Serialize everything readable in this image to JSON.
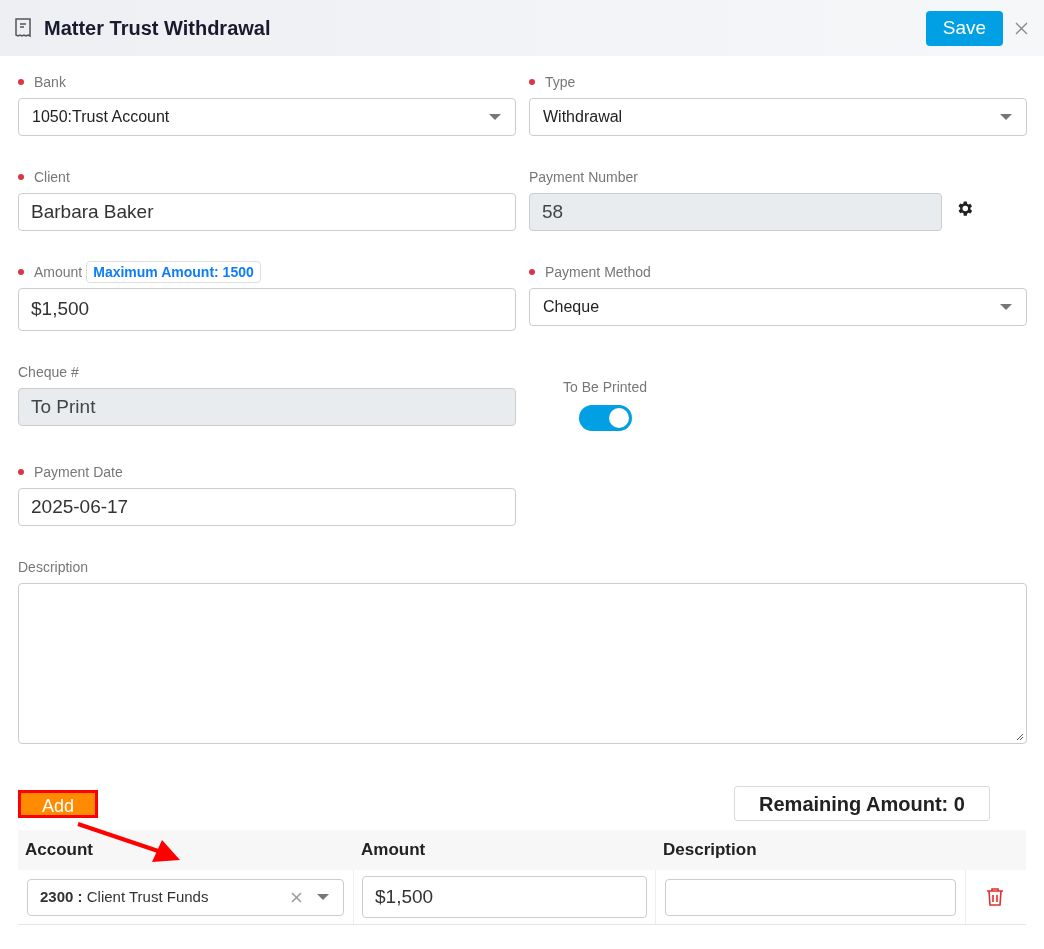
{
  "dialog": {
    "title": "Matter Trust Withdrawal",
    "save": "Save"
  },
  "fields": [
    {
      "kind": "select",
      "label": "Bank",
      "required": true,
      "value": "1050:Trust Account"
    },
    {
      "kind": "select",
      "label": "Type",
      "required": true,
      "value": "Withdrawal"
    },
    {
      "kind": "text",
      "label": "Client",
      "required": true,
      "value": "Barbara Baker"
    },
    {
      "kind": "readonly",
      "label": "Payment Number",
      "required": false,
      "value": "58",
      "settings": true
    },
    {
      "kind": "text",
      "label": "Amount",
      "required": true,
      "value": "$1,500",
      "badge": "Maximum Amount: 1500"
    },
    {
      "kind": "select",
      "label": "Payment Method",
      "required": true,
      "value": "Cheque"
    },
    {
      "kind": "readonly",
      "label": "Cheque #",
      "required": false,
      "value": "To Print"
    },
    {
      "kind": "toggle",
      "label": "To Be Printed",
      "on": true
    },
    {
      "kind": "text",
      "label": "Payment Date",
      "required": true,
      "value": "2025-06-17"
    },
    {
      "kind": "textarea",
      "label": "Description",
      "required": false
    }
  ],
  "lines": {
    "add_button": "Add",
    "remaining": "Remaining Amount: 0",
    "columns": [
      "Account",
      "Amount",
      "Description"
    ],
    "rows": [
      {
        "account": "**2300 :** Client Trust Funds",
        "amount": "$1,500"
      }
    ]
  }
}
